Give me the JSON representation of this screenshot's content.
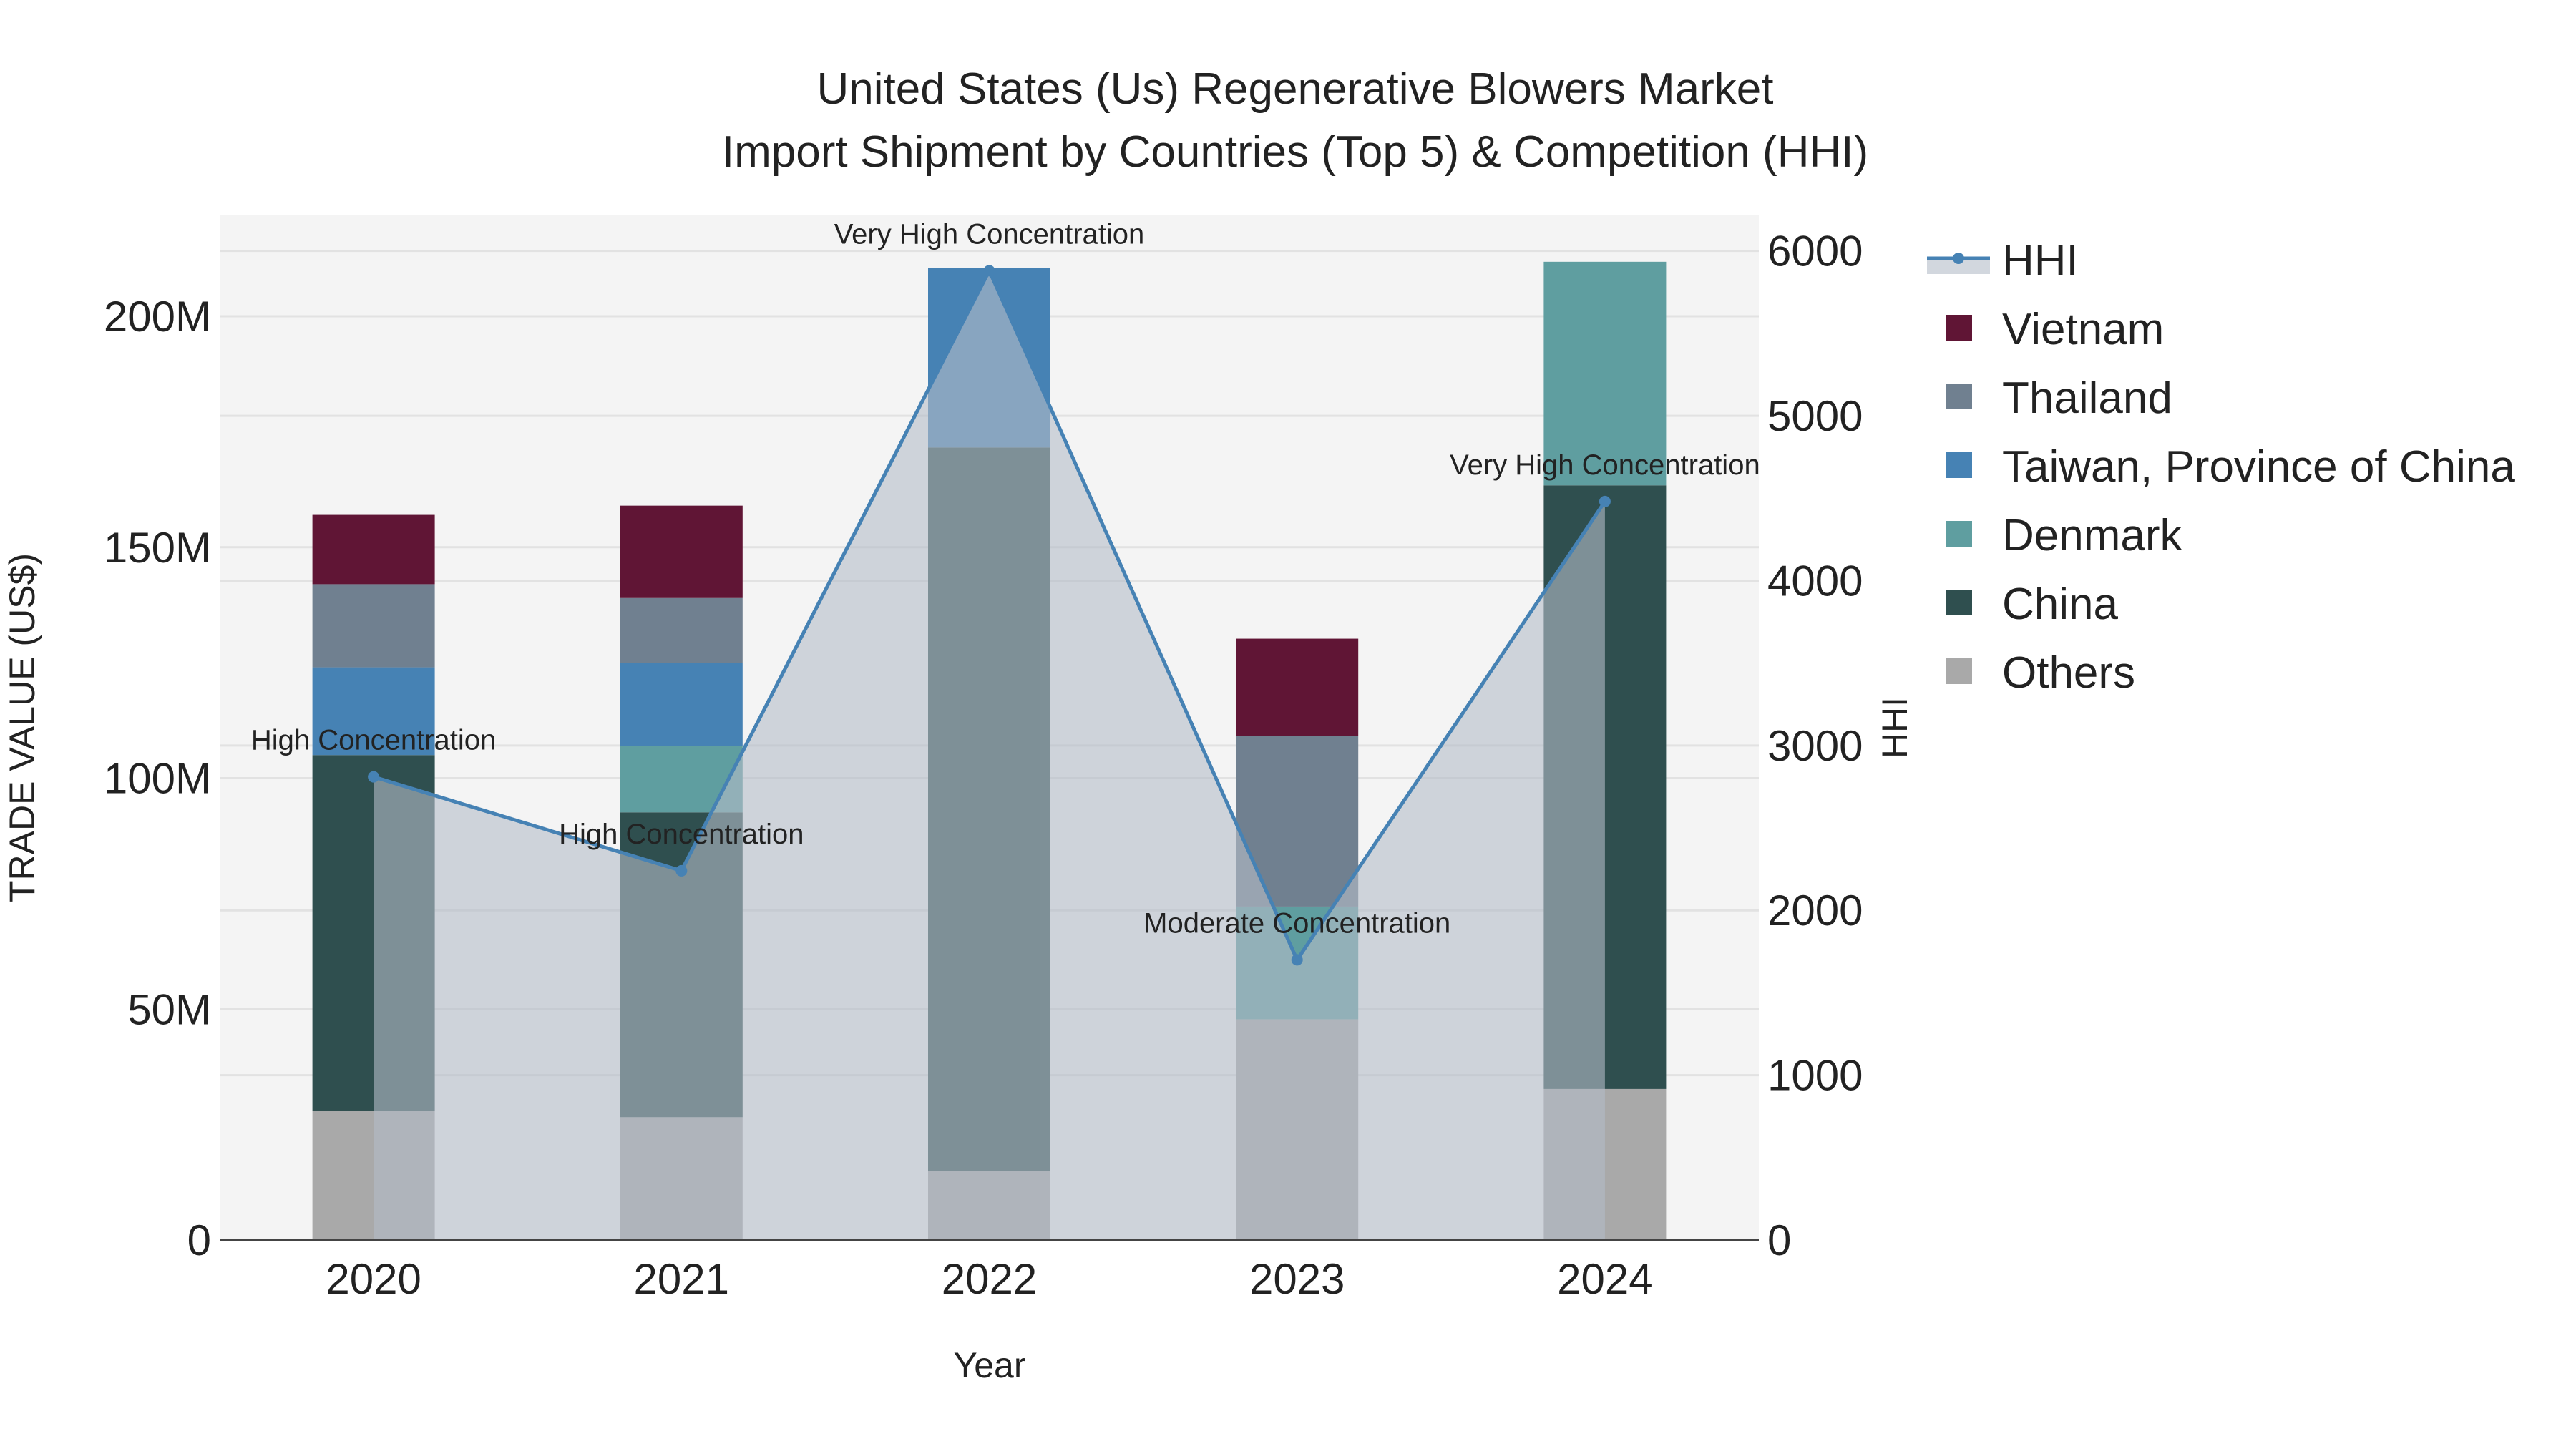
{
  "chart_data": {
    "type": "bar",
    "barmode": "stack",
    "title_line1": "United States (Us) Regenerative Blowers Market",
    "title_line2": "Import Shipment by Countries (Top 5) & Competition (HHI)",
    "xlabel": "Year",
    "ylabel": "TRADE VALUE (US$)",
    "y2label": "HHI",
    "categories": [
      "2020",
      "2021",
      "2022",
      "2023",
      "2024"
    ],
    "ylim": [
      0,
      222
    ],
    "yticks": [
      0,
      50,
      100,
      150,
      200
    ],
    "ytick_labels": [
      "0",
      "50M",
      "100M",
      "150M",
      "200M"
    ],
    "y2lim": [
      0,
      6220
    ],
    "y2ticks": [
      0,
      1000,
      2000,
      3000,
      4000,
      5000,
      6000
    ],
    "y2tick_labels": [
      "0",
      "1000",
      "2000",
      "3000",
      "4000",
      "5000",
      "6000"
    ],
    "units": "million US$",
    "series": [
      {
        "name": "Others",
        "color": "#a9a9a9",
        "values": [
          28,
          26.6,
          15,
          47.8,
          32.7
        ]
      },
      {
        "name": "China",
        "color": "#2f4f4f",
        "values": [
          77,
          66,
          156.6,
          0,
          130.7
        ]
      },
      {
        "name": "Denmark",
        "color": "#5f9ea0",
        "values": [
          0,
          14.4,
          0,
          24.4,
          48.4
        ]
      },
      {
        "name": "Taiwan, Province of China",
        "color": "#4682b4",
        "values": [
          19,
          18,
          38.8,
          0,
          0
        ]
      },
      {
        "name": "Thailand",
        "color": "#708090",
        "values": [
          18,
          14,
          0,
          37,
          0
        ]
      },
      {
        "name": "Vietnam",
        "color": "#601535",
        "values": [
          15,
          20,
          0,
          21,
          0
        ]
      }
    ],
    "legend_order": [
      "HHI",
      "Vietnam",
      "Thailand",
      "Taiwan, Province of China",
      "Denmark",
      "China",
      "Others"
    ],
    "legend_position": "right",
    "hhi": {
      "name": "HHI",
      "color": "#4682b4",
      "values": [
        2810,
        2240,
        5880,
        1700,
        4480
      ],
      "annotations": [
        "High Concentration",
        "High Concentration",
        "Very High Concentration",
        "Moderate Concentration",
        "Very High Concentration"
      ]
    },
    "grid": true
  }
}
